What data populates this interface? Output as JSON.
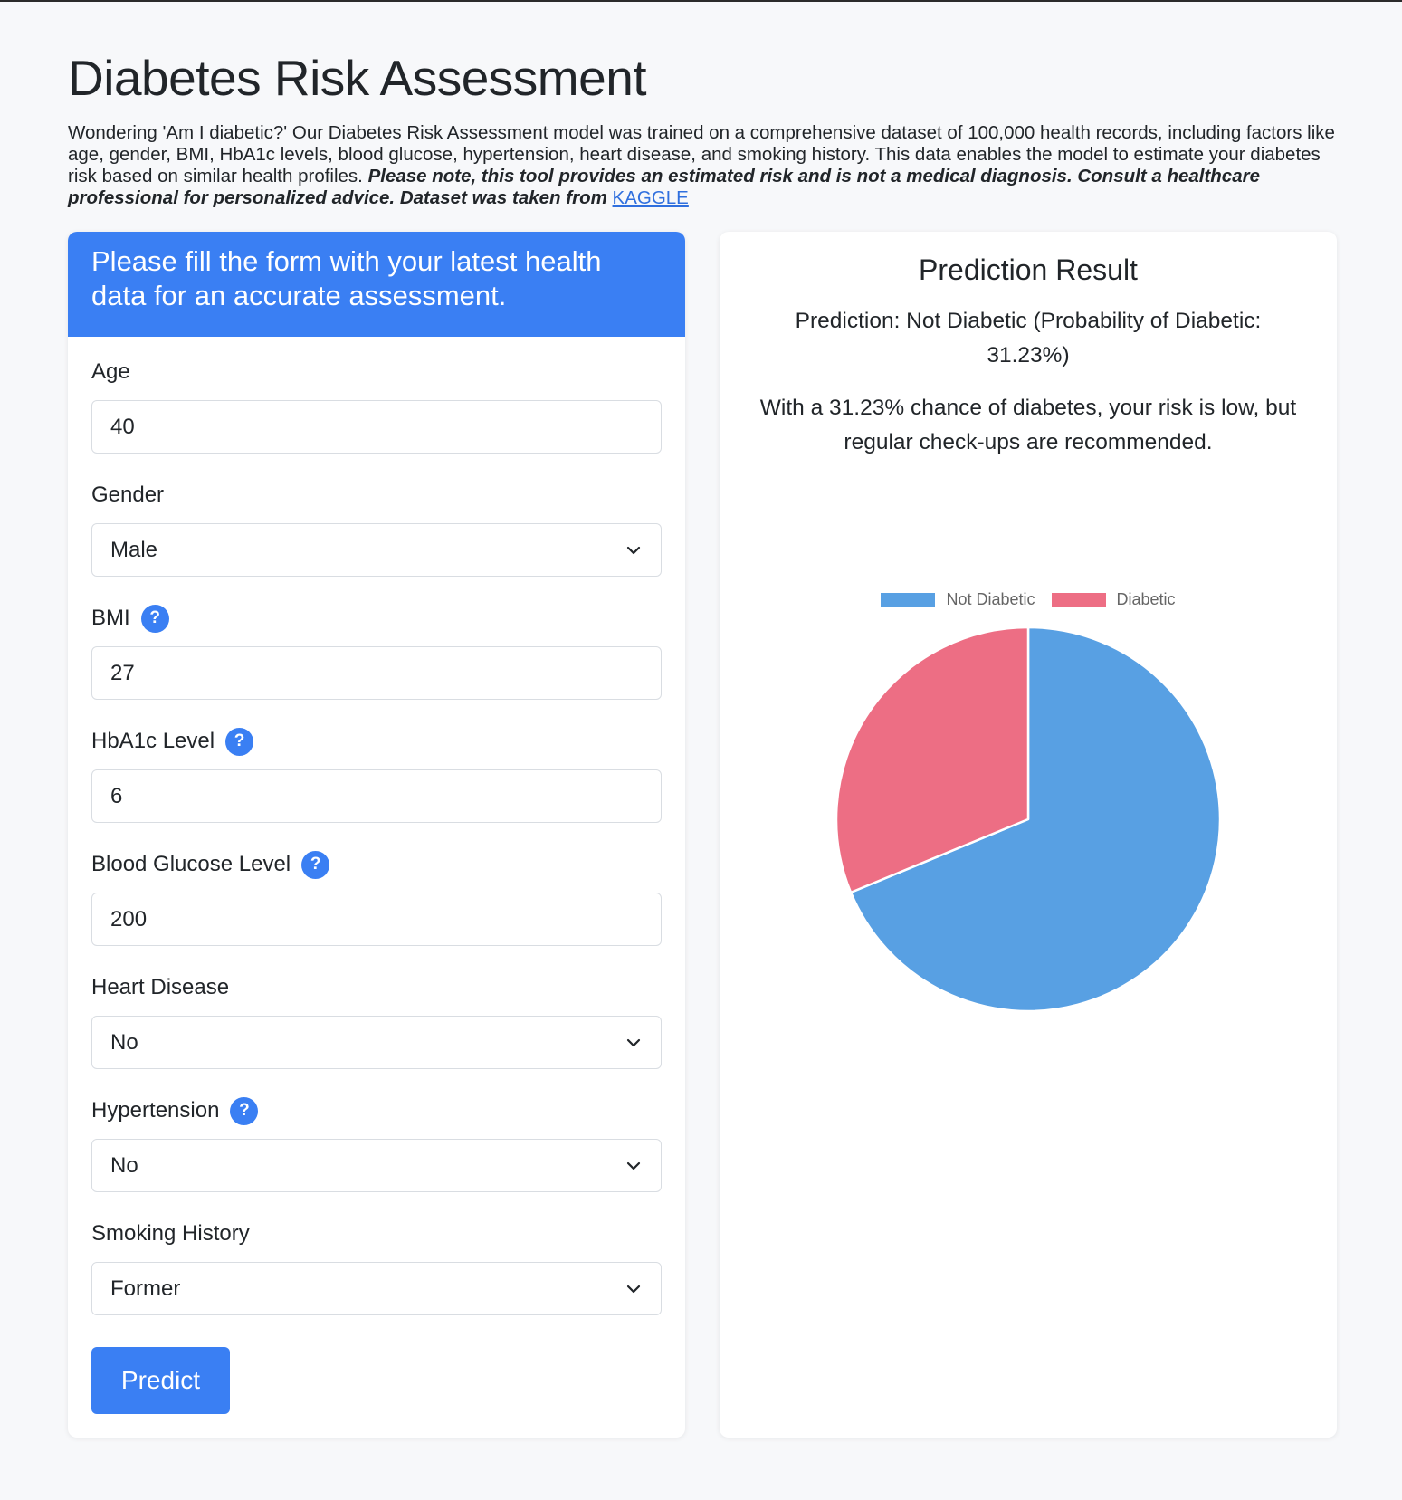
{
  "page": {
    "title": "Diabetes Risk Assessment",
    "intro_text": "Wondering 'Am I diabetic?' Our Diabetes Risk Assessment model was trained on a comprehensive dataset of 100,000 health records, including factors like age, gender, BMI, HbA1c levels, blood glucose, hypertension, heart disease, and smoking history. This data enables the model to estimate your diabetes risk based on similar health profiles.",
    "intro_bold": "Please note, this tool provides an estimated risk and is not a medical diagnosis. Consult a healthcare professional for personalized advice. Dataset was taken from",
    "dataset_link": "KAGGLE"
  },
  "form": {
    "header": "Please fill the form with your latest health data for an accurate assessment.",
    "fields": [
      {
        "label": "Age",
        "value": "40",
        "help": false,
        "type": "input"
      },
      {
        "label": "Gender",
        "value": "Male",
        "help": false,
        "type": "select"
      },
      {
        "label": "BMI",
        "value": "27",
        "help": true,
        "type": "input"
      },
      {
        "label": "HbA1c Level",
        "value": "6",
        "help": true,
        "type": "input"
      },
      {
        "label": "Blood Glucose Level",
        "value": "200",
        "help": true,
        "type": "input"
      },
      {
        "label": "Heart Disease",
        "value": "No",
        "help": false,
        "type": "select"
      },
      {
        "label": "Hypertension",
        "value": "No",
        "help": true,
        "type": "select"
      },
      {
        "label": "Smoking History",
        "value": "Former",
        "help": false,
        "type": "select"
      }
    ],
    "help_glyph": "?",
    "submit_label": "Predict"
  },
  "result": {
    "title": "Prediction Result",
    "prediction": "Prediction: Not Diabetic (Probability of Diabetic: 31.23%)",
    "note": "With a 31.23% chance of diabetes, your risk is low, but regular check-ups are recommended."
  },
  "colors": {
    "accent": "#3a7ff3",
    "not_diabetic": "#58a0e3",
    "diabetic": "#ed6e84"
  },
  "chart_data": {
    "type": "pie",
    "categories": [
      "Not Diabetic",
      "Diabetic"
    ],
    "values": [
      68.77,
      31.23
    ],
    "legend_position": "top"
  }
}
